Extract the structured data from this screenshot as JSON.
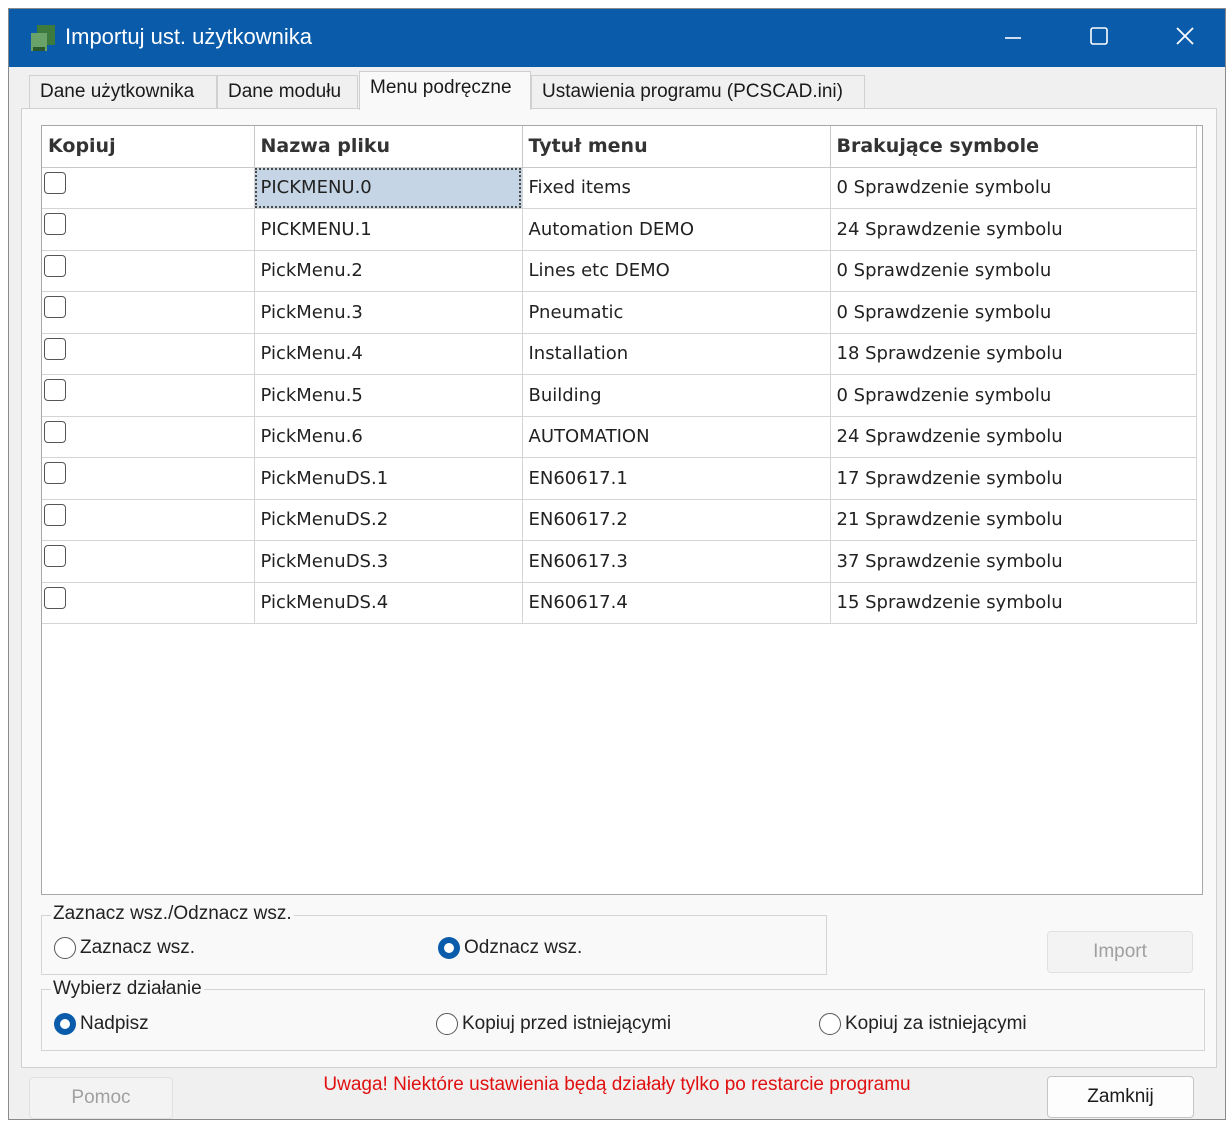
{
  "window": {
    "title": "Importuj ust. użytkownika",
    "controls": {
      "minimize": "minimize-icon",
      "maximize": "maximize-icon",
      "close": "close-icon"
    }
  },
  "tabs": [
    {
      "label": "Dane użytkownika",
      "active": false
    },
    {
      "label": "Dane modułu",
      "active": false
    },
    {
      "label": "Menu podręczne",
      "active": true
    },
    {
      "label": "Ustawienia programu (PCSCAD.ini)",
      "active": false
    }
  ],
  "grid": {
    "columns": [
      "Kopiuj",
      "Nazwa pliku",
      "Tytuł menu",
      "Brakujące symbole"
    ],
    "rows": [
      {
        "checked": false,
        "file": "PICKMENU.0",
        "title": "Fixed items",
        "missing": "0 Sprawdzenie symbolu"
      },
      {
        "checked": false,
        "file": "PICKMENU.1",
        "title": "Automation DEMO",
        "missing": "24 Sprawdzenie symbolu"
      },
      {
        "checked": false,
        "file": "PickMenu.2",
        "title": "Lines etc DEMO",
        "missing": "0 Sprawdzenie symbolu"
      },
      {
        "checked": false,
        "file": "PickMenu.3",
        "title": "Pneumatic",
        "missing": "0 Sprawdzenie symbolu"
      },
      {
        "checked": false,
        "file": "PickMenu.4",
        "title": "Installation",
        "missing": "18 Sprawdzenie symbolu"
      },
      {
        "checked": false,
        "file": "PickMenu.5",
        "title": "Building",
        "missing": "0 Sprawdzenie symbolu"
      },
      {
        "checked": false,
        "file": "PickMenu.6",
        "title": "AUTOMATION",
        "missing": "24 Sprawdzenie symbolu"
      },
      {
        "checked": false,
        "file": "PickMenuDS.1",
        "title": "EN60617.1",
        "missing": "17 Sprawdzenie symbolu"
      },
      {
        "checked": false,
        "file": "PickMenuDS.2",
        "title": "EN60617.2",
        "missing": "21 Sprawdzenie symbolu"
      },
      {
        "checked": false,
        "file": "PickMenuDS.3",
        "title": "EN60617.3",
        "missing": "37 Sprawdzenie symbolu"
      },
      {
        "checked": false,
        "file": "PickMenuDS.4",
        "title": "EN60617.4",
        "missing": "15 Sprawdzenie symbolu"
      }
    ]
  },
  "select_group": {
    "label": "Zaznacz wsz./Odznacz wsz.",
    "options": [
      {
        "label": "Zaznacz wsz.",
        "selected": false
      },
      {
        "label": "Odznacz wsz.",
        "selected": true
      }
    ]
  },
  "action_group": {
    "label": "Wybierz działanie",
    "options": [
      {
        "label": "Nadpisz",
        "selected": true
      },
      {
        "label": "Kopiuj przed istniejącymi",
        "selected": false
      },
      {
        "label": "Kopiuj za istniejącymi",
        "selected": false
      }
    ]
  },
  "buttons": {
    "import": "Import",
    "help": "Pomoc",
    "close": "Zamknij"
  },
  "footer": {
    "warning": "Uwaga! Niektóre ustawienia będą działały tylko po restarcie programu"
  },
  "colors": {
    "titlebar": "#0a5cab",
    "accent": "#0a5cab",
    "warning": "#e01010",
    "selection": "#c6d5e6"
  }
}
